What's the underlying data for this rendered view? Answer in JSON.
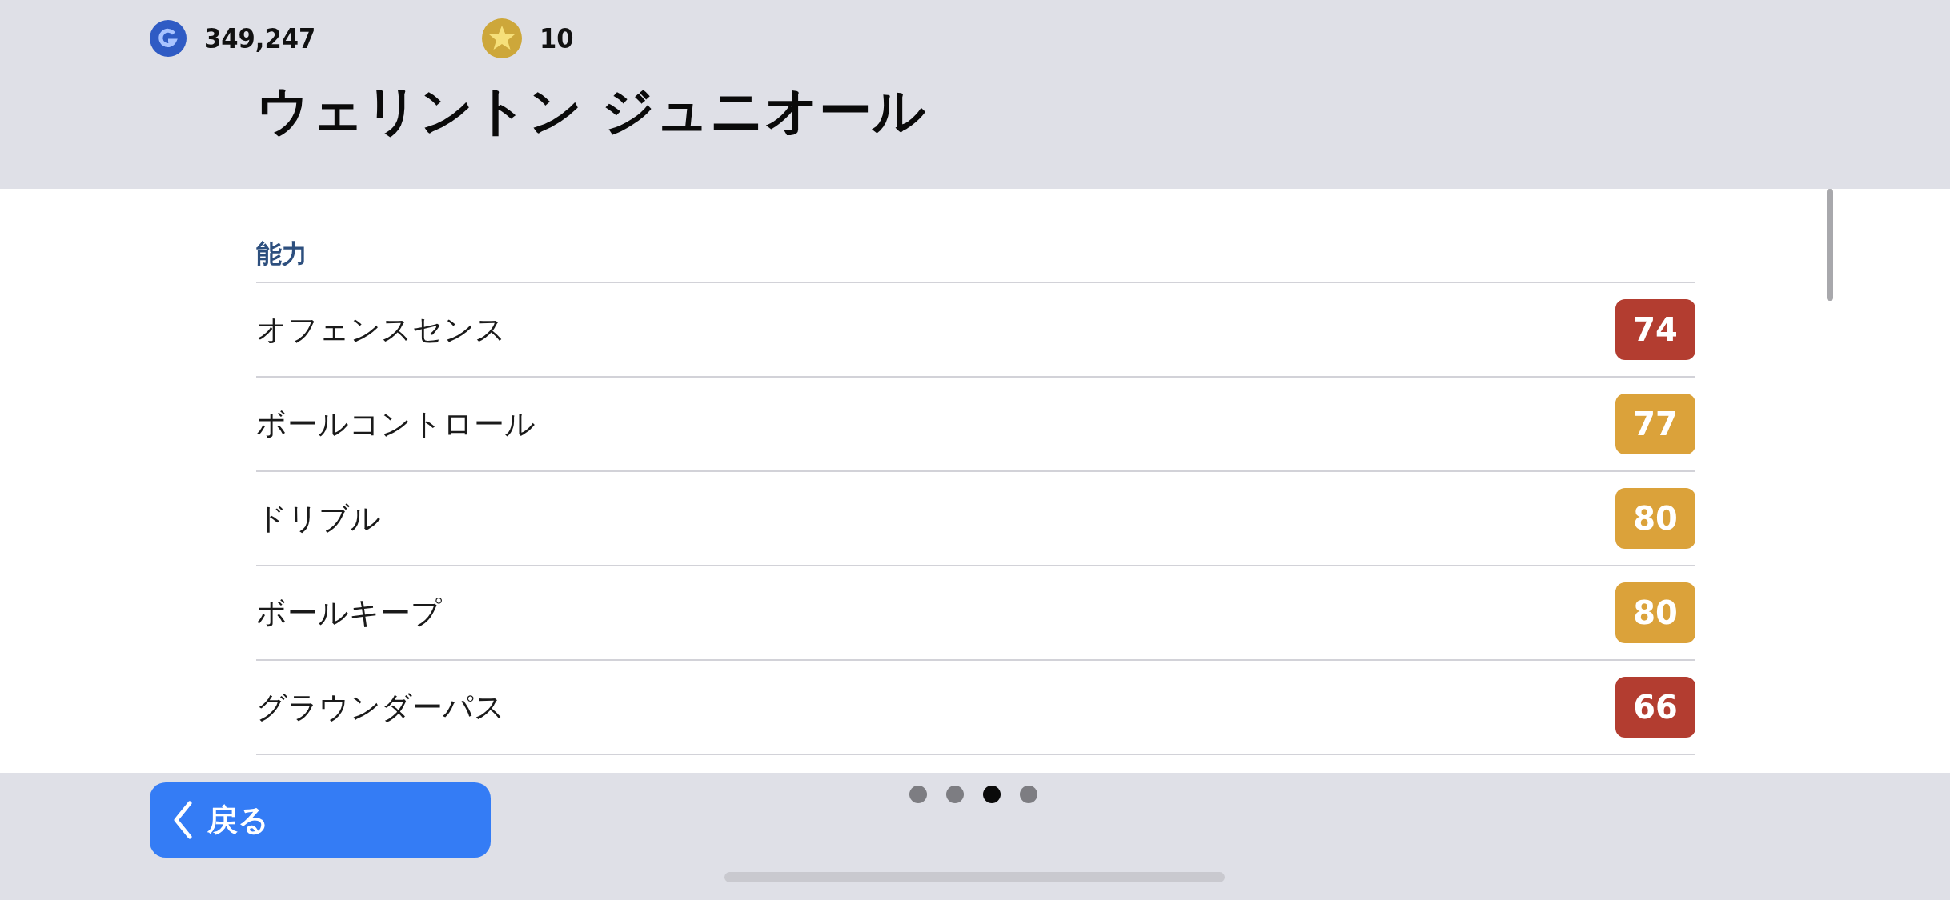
{
  "currencies": [
    {
      "kind": "g",
      "amount": "349,247"
    },
    {
      "kind": "star",
      "amount": "10"
    }
  ],
  "title": "ウェリントン ジュニオール",
  "section": "能力",
  "stats": [
    {
      "name": "オフェンスセンス",
      "value": "74",
      "color": "#b33d30"
    },
    {
      "name": "ボールコントロール",
      "value": "77",
      "color": "#dba23a"
    },
    {
      "name": "ドリブル",
      "value": "80",
      "color": "#dba23a"
    },
    {
      "name": "ボールキープ",
      "value": "80",
      "color": "#dba23a"
    },
    {
      "name": "グラウンダーパス",
      "value": "66",
      "color": "#b33d30"
    }
  ],
  "back_button": {
    "label": "戻る"
  },
  "pages": [
    {
      "selected": false
    },
    {
      "selected": false
    },
    {
      "selected": true
    },
    {
      "selected": false
    }
  ]
}
